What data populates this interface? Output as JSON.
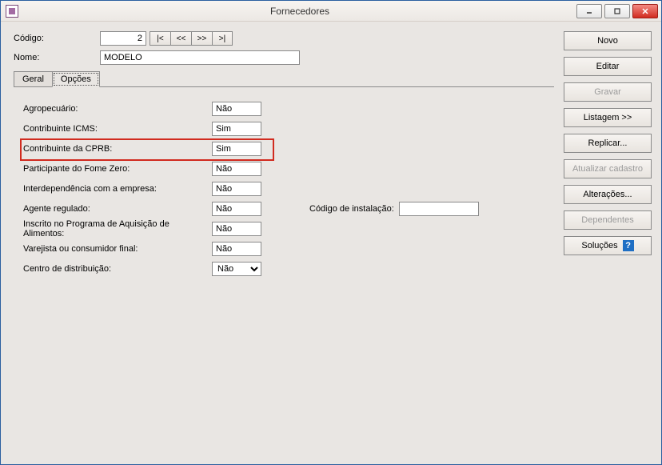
{
  "window": {
    "title": "Fornecedores"
  },
  "header": {
    "codigo_label": "Código:",
    "codigo_value": "2",
    "nome_label": "Nome:",
    "nome_value": "MODELO",
    "nav": {
      "first": "|<",
      "prev": "<<",
      "next": ">>",
      "last": ">|"
    }
  },
  "tabs": {
    "geral": "Geral",
    "opcoes": "Opções"
  },
  "options": {
    "agropecuario": {
      "label": "Agropecuário:",
      "value": "Não"
    },
    "contribuinte_icms": {
      "label": "Contribuinte ICMS:",
      "value": "Sim"
    },
    "contribuinte_cprb": {
      "label": "Contribuinte da CPRB:",
      "value": "Sim"
    },
    "fome_zero": {
      "label": "Participante do Fome Zero:",
      "value": "Não"
    },
    "interdependencia": {
      "label": "Interdependência com a empresa:",
      "value": "Não"
    },
    "agente_regulado": {
      "label": "Agente regulado:",
      "value": "Não"
    },
    "codigo_instalacao_label": "Código de instalação:",
    "codigo_instalacao_value": "",
    "inscrito_paa": {
      "label": "Inscrito no Programa de Aquisição de Alimentos:",
      "value": "Não"
    },
    "varejista": {
      "label": "Varejista ou consumidor final:",
      "value": "Não"
    },
    "centro_distribuicao": {
      "label": "Centro de distribuição:",
      "value": "Não"
    }
  },
  "sidebar": {
    "novo": "Novo",
    "editar": "Editar",
    "gravar": "Gravar",
    "listagem": "Listagem >>",
    "replicar": "Replicar...",
    "atualizar": "Atualizar cadastro",
    "alteracoes": "Alterações...",
    "dependentes": "Dependentes",
    "solucoes": "Soluções"
  }
}
